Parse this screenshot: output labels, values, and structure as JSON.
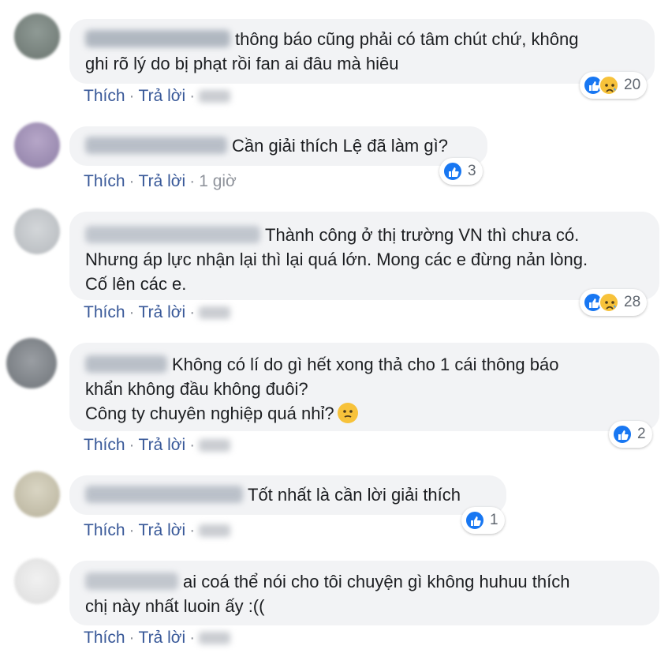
{
  "actions": {
    "like_label": "Thích",
    "reply_label": "Trả lời",
    "separator": "·"
  },
  "colors": {
    "link": "#385898",
    "bubble": "#f2f3f5",
    "like_blue": "#1877f2",
    "sad_yellow": "#f7c23a",
    "meta_gray": "#90949c"
  },
  "comments": [
    {
      "line1": "thông báo cũng phải có tâm chút chứ, không",
      "line2": "ghi rõ lý do bị phạt rồi fan ai đâu mà hiêu",
      "reaction_icons": [
        "like-icon",
        "sad-icon"
      ],
      "reaction_count": "20",
      "time": ""
    },
    {
      "line1": "Cần giải thích Lệ đã làm gì?",
      "reaction_icons": [
        "like-icon"
      ],
      "reaction_count": "3",
      "time": "1 giờ"
    },
    {
      "line1": "Thành công ở thị trường VN thì chưa có.",
      "line2": "Nhưng áp lực nhận lại thì lại quá lớn. Mong các e đừng nản lòng.",
      "line3": "Cố lên các e.",
      "reaction_icons": [
        "like-icon",
        "sad-icon"
      ],
      "reaction_count": "28",
      "time": ""
    },
    {
      "line1": "Không có lí do gì hết xong thả cho 1 cái thông báo",
      "line2": "khẩn không đầu không đuôi?",
      "line3": "Công ty chuyên nghiệp quá nhỉ?",
      "line3_emoji": "worried-face-icon",
      "reaction_icons": [
        "like-icon"
      ],
      "reaction_count": "2",
      "time": ""
    },
    {
      "line1": "Tốt nhất là cần lời giải thích",
      "reaction_icons": [
        "like-icon"
      ],
      "reaction_count": "1",
      "time": ""
    },
    {
      "line1": "ai coá thể nói cho tôi chuyện gì không huhuu thích",
      "line2": "chị này nhất luoin ấy :((",
      "reaction_icons": [],
      "reaction_count": "",
      "time": ""
    }
  ]
}
